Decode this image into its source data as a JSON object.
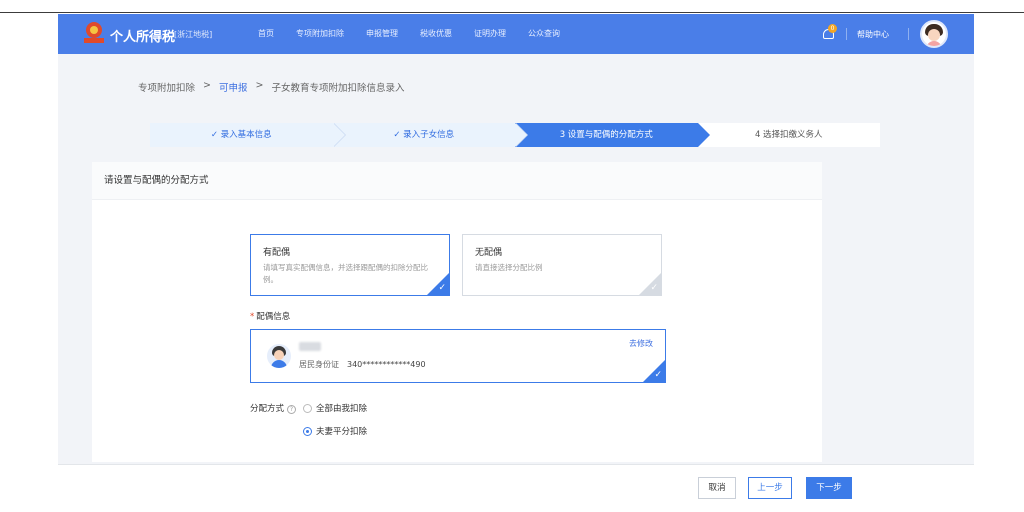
{
  "header": {
    "brand": "个人所得税",
    "region": "[浙江地税]",
    "nav": [
      "首页",
      "专项附加扣除",
      "申报管理",
      "税收优惠",
      "证明办理",
      "公众查询"
    ],
    "notification_count": "0",
    "help": "帮助中心"
  },
  "breadcrumb": {
    "items": [
      "专项附加扣除",
      "可申报",
      "子女教育专项附加扣除信息录入"
    ],
    "sep": ">"
  },
  "steps": [
    {
      "label": "✓ 录入基本信息",
      "state": "done"
    },
    {
      "label": "✓ 录入子女信息",
      "state": "done"
    },
    {
      "label": "3 设置与配偶的分配方式",
      "state": "active"
    },
    {
      "label": "4 选择扣缴义务人",
      "state": "todo"
    }
  ],
  "card": {
    "title": "请设置与配偶的分配方式",
    "options": [
      {
        "title": "有配偶",
        "desc": "请填写真实配偶信息，并选择跟配偶的扣除分配比例。",
        "selected": true
      },
      {
        "title": "无配偶",
        "desc": "请直接选择分配比例",
        "selected": false
      }
    ],
    "spouse_label": "配偶信息",
    "spouse": {
      "id_type": "居民身份证",
      "id_number": "340************490",
      "edit": "去修改"
    },
    "alloc_label": "分配方式",
    "alloc_options": [
      {
        "label": "全部由我扣除",
        "checked": false
      },
      {
        "label": "夫妻平分扣除",
        "checked": true
      }
    ]
  },
  "footer": {
    "cancel": "取消",
    "prev": "上一步",
    "next": "下一步"
  },
  "colors": {
    "primary": "#3c7be8",
    "header": "#4a7ee8",
    "required": "#e04a2c"
  }
}
